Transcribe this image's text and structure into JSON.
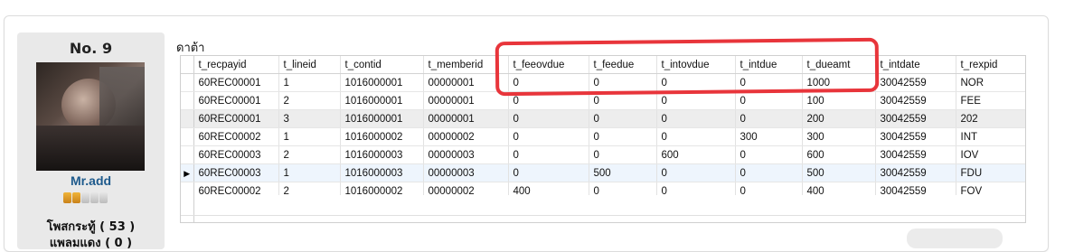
{
  "post": {
    "number": "No. 9",
    "username": "Mr.add",
    "medals": {
      "filled": 2,
      "total": 5
    },
    "stat_line_1": "โพสกระทู้ ( 53 )",
    "stat_line_2": "แพลมแดง ( 0 )"
  },
  "grid": {
    "caption": "ดาต้า",
    "columns": [
      "t_recpayid",
      "t_lineid",
      "t_contid",
      "t_memberid",
      "t_feeovdue",
      "t_feedue",
      "t_intovdue",
      "t_intdue",
      "t_dueamt",
      "t_intdate",
      "t_rexpid"
    ],
    "rows": [
      [
        "60REC00001",
        "1",
        "1016000001",
        "00000001",
        "0",
        "0",
        "0",
        "0",
        "1000",
        "30042559",
        "NOR"
      ],
      [
        "60REC00001",
        "2",
        "1016000001",
        "00000001",
        "0",
        "0",
        "0",
        "0",
        "100",
        "30042559",
        "FEE"
      ],
      [
        "60REC00001",
        "3",
        "1016000001",
        "00000001",
        "0",
        "0",
        "0",
        "0",
        "200",
        "30042559",
        "202"
      ],
      [
        "60REC00002",
        "1",
        "1016000002",
        "00000002",
        "0",
        "0",
        "0",
        "300",
        "300",
        "30042559",
        "INT"
      ],
      [
        "60REC00003",
        "2",
        "1016000003",
        "00000003",
        "0",
        "0",
        "600",
        "0",
        "600",
        "30042559",
        "IOV"
      ],
      [
        "60REC00003",
        "1",
        "1016000003",
        "00000003",
        "0",
        "500",
        "0",
        "0",
        "500",
        "30042559",
        "FDU"
      ],
      [
        "60REC00002",
        "2",
        "1016000002",
        "00000002",
        "400",
        "0",
        "0",
        "0",
        "400",
        "30042559",
        "FOV"
      ]
    ],
    "current_row_marker": "▶"
  },
  "annotation": {
    "color": "#e8353b",
    "shape": "rounded-rectangle"
  },
  "colors": {
    "username": "#1e5a8c",
    "alt_row": "#ededed",
    "selected_row": "#eef5fd"
  }
}
